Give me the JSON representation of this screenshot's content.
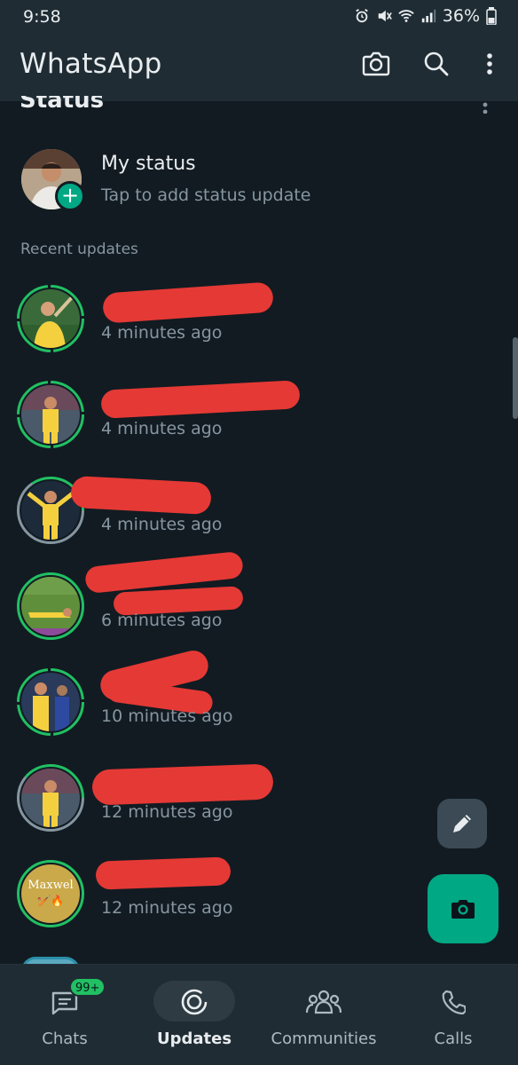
{
  "status_bar": {
    "time": "9:58",
    "battery": "36%"
  },
  "app_bar": {
    "title": "WhatsApp",
    "camera_icon": "camera-icon",
    "search_icon": "search-icon",
    "menu_icon": "more-vert-icon"
  },
  "section": {
    "title": "Status"
  },
  "my_status": {
    "name": "My status",
    "subtitle": "Tap to add status update"
  },
  "recent_label": "Recent updates",
  "updates": [
    {
      "time": "4 minutes ago",
      "ring": "green"
    },
    {
      "time": "4 minutes ago",
      "ring": "green"
    },
    {
      "time": "4 minutes ago",
      "ring": "mixed"
    },
    {
      "time": "6 minutes ago",
      "ring": "green"
    },
    {
      "time": "10 minutes ago",
      "ring": "green"
    },
    {
      "time": "12 minutes ago",
      "ring": "mixed"
    },
    {
      "time": "12 minutes ago",
      "ring": "green",
      "avatar_text": "Maxwel",
      "avatar_emoji": "🏏🔥"
    }
  ],
  "fabs": {
    "pencil_icon": "pencil-icon",
    "camera_icon": "camera-icon"
  },
  "bottom_nav": {
    "items": [
      {
        "label": "Chats",
        "icon": "chats-icon",
        "badge": "99+"
      },
      {
        "label": "Updates",
        "icon": "updates-icon",
        "active": true
      },
      {
        "label": "Communities",
        "icon": "communities-icon"
      },
      {
        "label": "Calls",
        "icon": "calls-icon"
      }
    ]
  },
  "colors": {
    "background": "#121b22",
    "bar": "#1f2c34",
    "accent": "#00a884",
    "secondary_text": "#8696a0",
    "redaction": "#e53935"
  }
}
